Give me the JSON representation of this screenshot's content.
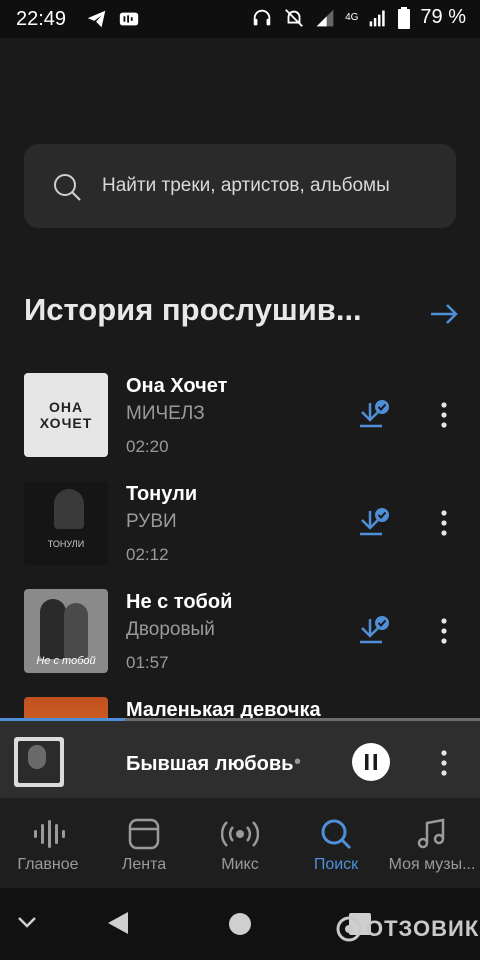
{
  "statusbar": {
    "time": "22:49",
    "network": "4G",
    "battery_pct": "79 %"
  },
  "search": {
    "placeholder": "Найти треки, артистов, альбомы"
  },
  "history": {
    "title": "История прослушив..."
  },
  "tracks": [
    {
      "title": "Она Хочет",
      "artist": "МИЧЕЛЗ",
      "duration": "02:20",
      "cover_text": "ОНА ХОЧЕТ"
    },
    {
      "title": "Тонули",
      "artist": "РУВИ",
      "duration": "02:12",
      "cover_text": "ТОНУЛИ"
    },
    {
      "title": "Не с тобой",
      "artist": "Дворовый",
      "duration": "01:57",
      "cover_text": "Не с тобой"
    },
    {
      "title": "Маленькая девочка"
    }
  ],
  "mini_player": {
    "title": "Бывшая любовь",
    "separator": "•",
    "progress": 0.26
  },
  "nav": [
    {
      "label": "Главное",
      "icon": "waveform-icon"
    },
    {
      "label": "Лента",
      "icon": "feed-icon"
    },
    {
      "label": "Микс",
      "icon": "broadcast-icon"
    },
    {
      "label": "Поиск",
      "icon": "search-icon",
      "active": true
    },
    {
      "label": "Моя музы...",
      "icon": "music-note-icon"
    }
  ],
  "watermark": "ОТЗОВИК",
  "colors": {
    "accent": "#4f8fd8",
    "background": "#1a1a1a",
    "secondary_text": "#9a9a9a"
  }
}
